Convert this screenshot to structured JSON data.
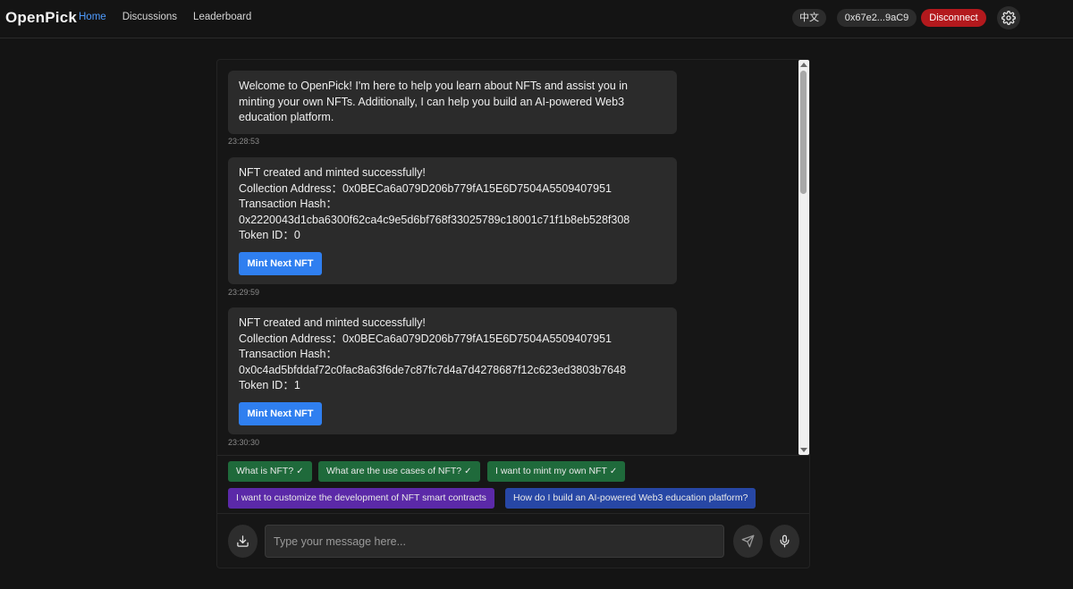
{
  "header": {
    "logo": "OpenPick",
    "nav": [
      {
        "label": "Home",
        "active": true
      },
      {
        "label": "Discussions",
        "active": false
      },
      {
        "label": "Leaderboard",
        "active": false
      }
    ],
    "language_label": "中文",
    "wallet_address": "0x67e2...9aC9",
    "disconnect_label": "Disconnect",
    "settings_icon": "gear-icon"
  },
  "messages": [
    {
      "lines": [
        "Welcome to OpenPick! I'm here to help you learn about NFTs and assist you in minting your own NFTs. Additionally, I can help you build an AI-powered Web3 education platform."
      ],
      "time": "23:28:53"
    },
    {
      "lines": [
        "NFT created and minted successfully!",
        "Collection Address：0x0BECa6a079D206b779fA15E6D7504A5509407951",
        "Transaction Hash：",
        "0x2220043d1cba6300f62ca4c9e5d6bf768f33025789c18001c71f1b8eb528f308",
        "Token ID：0"
      ],
      "button": "Mint Next NFT",
      "time": "23:29:59"
    },
    {
      "lines": [
        "NFT created and minted successfully!",
        "Collection Address：0x0BECa6a079D206b779fA15E6D7504A5509407951",
        "Transaction Hash：",
        "0x0c4ad5bfddaf72c0fac8a63f6de7c87fc7d4a7d4278687f12c623ed3803b7648",
        "Token ID：1"
      ],
      "button": "Mint Next NFT",
      "time": "23:30:30"
    }
  ],
  "suggestions": [
    {
      "label": "What is NFT?",
      "checked": true,
      "color": "#1f6a3b"
    },
    {
      "label": "What are the use cases of NFT?",
      "checked": true,
      "color": "#1f6a3b"
    },
    {
      "label": "I want to mint my own NFT",
      "checked": true,
      "color": "#1f6a3b"
    },
    {
      "label": "I want to customize the development of NFT smart contracts",
      "checked": false,
      "color": "#5b29a8"
    },
    {
      "label": "How do I build an AI-powered Web3 education platform?",
      "checked": false,
      "color": "#2747a5"
    }
  ],
  "composer": {
    "placeholder": "Type your message here...",
    "value": "",
    "download_icon": "download-icon",
    "send_icon": "send-icon",
    "mic_icon": "microphone-icon"
  },
  "colors": {
    "accent": "#4f9cff",
    "button_blue": "#2f7ff0",
    "disconnect_red": "#b3191d"
  }
}
